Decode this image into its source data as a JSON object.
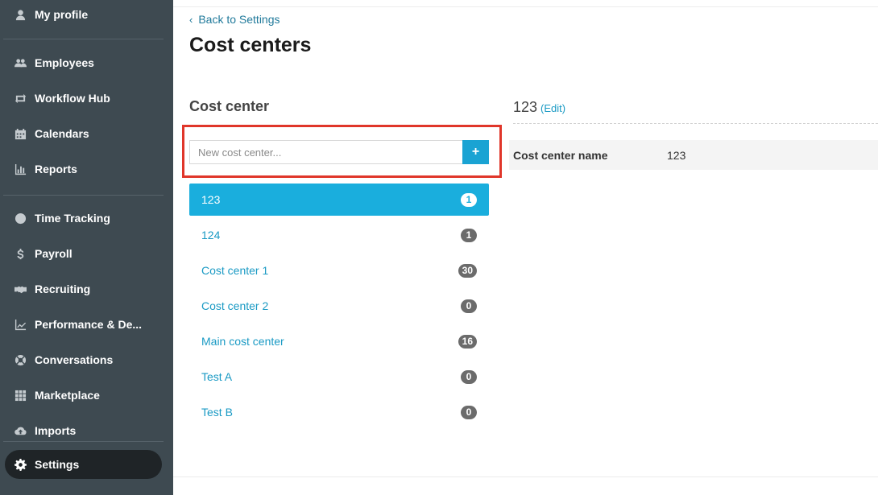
{
  "sidebar": {
    "items": [
      {
        "label": "My profile",
        "icon": "user-icon"
      },
      {
        "label": "Employees",
        "icon": "users-icon"
      },
      {
        "label": "Workflow Hub",
        "icon": "workflow-icon"
      },
      {
        "label": "Calendars",
        "icon": "calendar-icon"
      },
      {
        "label": "Reports",
        "icon": "chart-icon"
      },
      {
        "label": "Time Tracking",
        "icon": "clock-icon"
      },
      {
        "label": "Payroll",
        "icon": "dollar-icon"
      },
      {
        "label": "Recruiting",
        "icon": "handshake-icon"
      },
      {
        "label": "Performance & De...",
        "icon": "trend-icon"
      },
      {
        "label": "Conversations",
        "icon": "lifebuoy-icon"
      },
      {
        "label": "Marketplace",
        "icon": "grid-icon"
      },
      {
        "label": "Imports",
        "icon": "cloud-upload-icon"
      },
      {
        "label": "Settings",
        "icon": "gear-icon",
        "active": true
      }
    ]
  },
  "header": {
    "back_label": "Back to Settings",
    "title": "Cost centers"
  },
  "cost_center_panel": {
    "title": "Cost center",
    "input_placeholder": "New cost center...",
    "add_label": "+",
    "items": [
      {
        "name": "123",
        "count": "1",
        "selected": true
      },
      {
        "name": "124",
        "count": "1"
      },
      {
        "name": "Cost center 1",
        "count": "30"
      },
      {
        "name": "Cost center 2",
        "count": "0"
      },
      {
        "name": "Main cost center",
        "count": "16"
      },
      {
        "name": "Test A",
        "count": "0"
      },
      {
        "name": "Test B",
        "count": "0"
      }
    ]
  },
  "detail": {
    "title": "123",
    "edit_label": "(Edit)",
    "field_label": "Cost center name",
    "field_value": "123"
  },
  "colors": {
    "sidebar_bg": "#3e4a51",
    "accent": "#1aaedd",
    "highlight": "#e0362a"
  }
}
